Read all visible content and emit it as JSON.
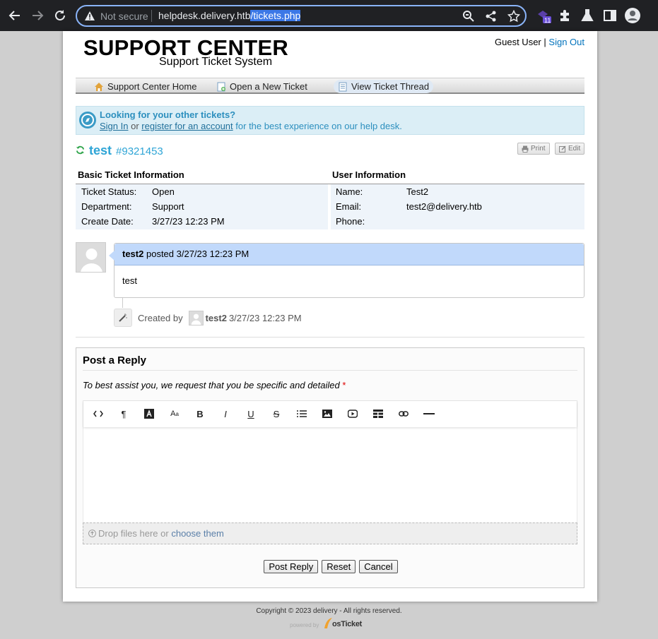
{
  "browser": {
    "not_secure": "Not secure",
    "url_host": "helpdesk.delivery.htb",
    "url_path": "/tickets.php",
    "ext_badge": "11"
  },
  "header": {
    "logo_title": "SUPPORT CENTER",
    "logo_subtitle": "Support Ticket System",
    "guest": "Guest User",
    "separator": "|",
    "sign_out": "Sign Out"
  },
  "nav": [
    {
      "label": "Support Center Home",
      "icon": "home-icon"
    },
    {
      "label": "Open a New Ticket",
      "icon": "new-ticket-icon"
    },
    {
      "label": "View Ticket Thread",
      "icon": "ticket-thread-icon"
    }
  ],
  "notice": {
    "heading": "Looking for your other tickets?",
    "sign_in": "Sign In",
    "or": "or",
    "register": "register for an account",
    "rest": "for the best experience on our help desk."
  },
  "ticket": {
    "subject": "test",
    "number": "#9321453",
    "print": "Print",
    "edit": "Edit"
  },
  "basic_info": {
    "heading": "Basic Ticket Information",
    "rows": [
      {
        "label": "Ticket Status:",
        "value": "Open"
      },
      {
        "label": "Department:",
        "value": "Support"
      },
      {
        "label": "Create Date:",
        "value": "3/27/23 12:23 PM"
      }
    ]
  },
  "user_info": {
    "heading": "User Information",
    "rows": [
      {
        "label": "Name:",
        "value": "Test2"
      },
      {
        "label": "Email:",
        "value": "test2@delivery.htb"
      },
      {
        "label": "Phone:",
        "value": ""
      }
    ]
  },
  "thread": {
    "author": "test2",
    "posted": "posted 3/27/23 12:23 PM",
    "body": "test",
    "event_created_by": "Created by",
    "event_user": "test2",
    "event_time": "3/27/23 12:23 PM"
  },
  "reply": {
    "title": "Post a Reply",
    "hint": "To best assist you, we request that you be specific and detailed",
    "required_mark": "*",
    "toolbar": [
      "code-view-icon",
      "paragraph-icon",
      "text-color-icon",
      "font-size-icon",
      "bold-icon",
      "italic-icon",
      "underline-icon",
      "strikethrough-icon",
      "list-icon",
      "image-icon",
      "video-icon",
      "table-icon",
      "link-icon",
      "horizontal-rule-icon"
    ],
    "drop_text": "Drop files here or",
    "drop_link": "choose them",
    "post_button": "Post Reply",
    "reset_button": "Reset",
    "cancel_button": "Cancel"
  },
  "footer": {
    "copyright": "Copyright © 2023 delivery - All rights reserved.",
    "powered_by": "powered by",
    "brand": "osTicket"
  }
}
